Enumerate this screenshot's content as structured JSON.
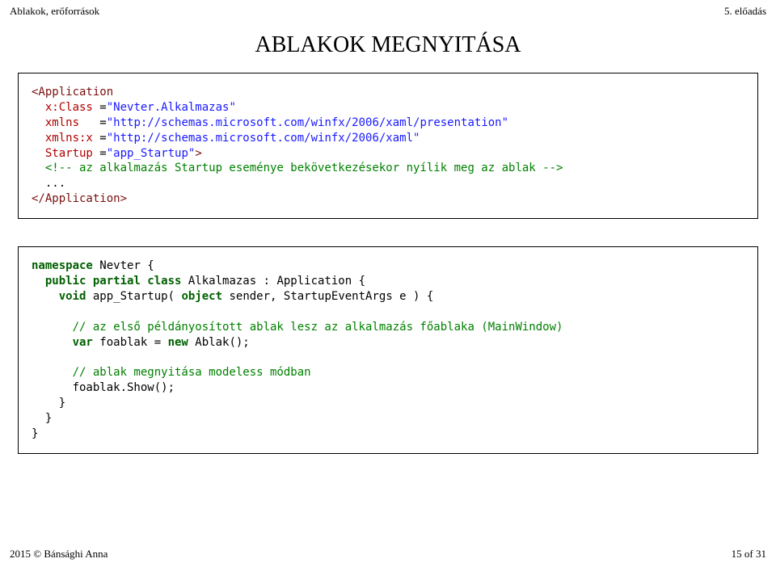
{
  "header": {
    "left": "Ablakok, erőforrások",
    "right": "5. előadás"
  },
  "title": "ABLAKOK MEGNYITÁSA",
  "code1": {
    "l1_tag_open": "<Application",
    "l2_attr": "  x:Class ",
    "l2_val": "\"Nevter.Alkalmazas\"",
    "l3_attr": "  xmlns   ",
    "l3_val": "\"http://schemas.microsoft.com/winfx/2006/xaml/presentation\"",
    "l4_attr": "  xmlns:x ",
    "l4_val": "\"http://schemas.microsoft.com/winfx/2006/xaml\"",
    "l5_attr": "  Startup ",
    "l5_val": "\"app_Startup\"",
    "l5_close": ">",
    "l6_cmnt": "  <!-- az alkalmazás Startup eseménye bekövetkezésekor nyílik meg az ablak -->",
    "l7": "  ...",
    "l8_tag_close": "</Application>"
  },
  "code2": {
    "l1a": "namespace",
    "l1b": " Nevter {",
    "l2a": "  public partial class",
    "l2b": " Alkalmazas : Application {",
    "l3a": "    void",
    "l3b": " app_Startup( ",
    "l3c": "object",
    "l3d": " sender, StartupEventArgs e ) {",
    "l4": "",
    "l5": "      // az első példányosított ablak lesz az alkalmazás főablaka (MainWindow)",
    "l6a": "      var",
    "l6b": " foablak = ",
    "l6c": "new",
    "l6d": " Ablak();",
    "l7": "",
    "l8": "      // ablak megnyitása modeless módban",
    "l9": "      foablak.Show();",
    "l10": "    }",
    "l11": "  }",
    "l12": "}"
  },
  "footer": {
    "left": "2015 © Bánsághi Anna",
    "right": "15 of 31"
  }
}
